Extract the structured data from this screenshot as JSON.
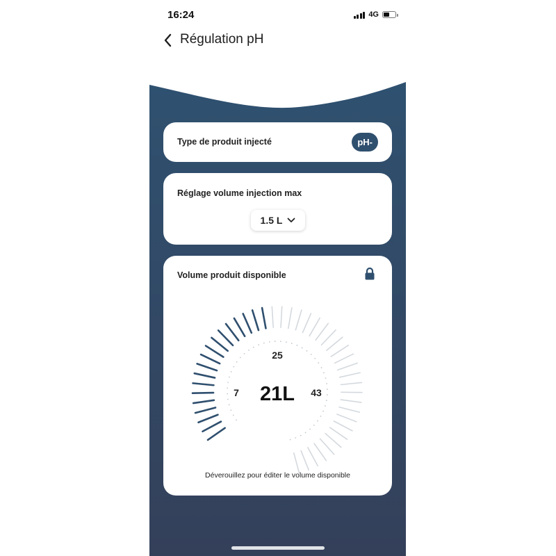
{
  "status_bar": {
    "time": "16:24",
    "network": "4G",
    "battery_level": 0.45
  },
  "header": {
    "back_icon": "chevron-left-icon",
    "title": "Régulation pH"
  },
  "product_card": {
    "label": "Type de produit injecté",
    "value": "pH-"
  },
  "volume_max_card": {
    "label": "Réglage volume injection max",
    "selected_value": "1.5 L",
    "dropdown_icon": "chevron-down-icon"
  },
  "available_card": {
    "label": "Volume produit disponible",
    "lock_icon": "lock-icon",
    "gauge": {
      "value_label": "21L",
      "value": 21,
      "scale_min_label": "7",
      "scale_mid_label": "25",
      "scale_max_label": "43"
    },
    "hint": "Déverouillez pour éditer le volume disponible"
  },
  "colors": {
    "primary": "#2f4f6e",
    "background_top": "#2f5170",
    "background_bottom": "#34405a",
    "inactive_tick": "#d4d9de"
  }
}
